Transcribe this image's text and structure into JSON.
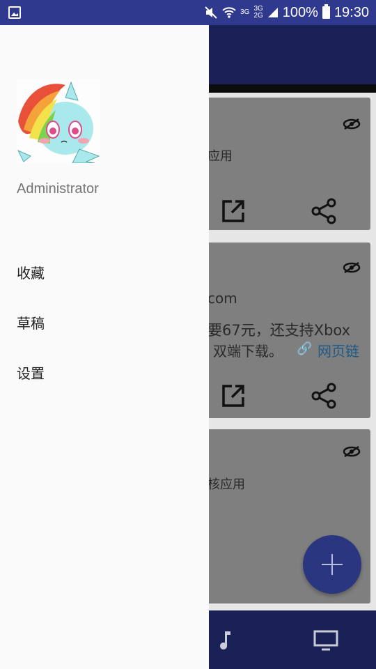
{
  "status_bar": {
    "network_top": "3G",
    "network_mid": "3G",
    "network_low": "2G",
    "battery": "100%",
    "time": "19:30",
    "icons": [
      "image-icon",
      "mute-icon",
      "wifi-icon",
      "signal-icon",
      "battery-icon"
    ]
  },
  "drawer": {
    "username": "Administrator",
    "menu": [
      {
        "label": "收藏"
      },
      {
        "label": "草稿"
      },
      {
        "label": "设置"
      }
    ]
  },
  "background": {
    "cards": [
      {
        "line1": "应用",
        "line2": "",
        "line3": ""
      },
      {
        "line1": "com",
        "line2": "要67元，还支持Xbox",
        "line3": "双端下载。",
        "link": "网页链"
      },
      {
        "line1": "核应用"
      }
    ],
    "bottom_nav_icons": [
      "music-icon",
      "tv-icon"
    ],
    "fab_icon": "plus-icon"
  },
  "colors": {
    "statusbar": "#2f3a8f",
    "toolbar": "#1a2157",
    "fab": "#2a3680",
    "drawer": "#fafafa"
  }
}
